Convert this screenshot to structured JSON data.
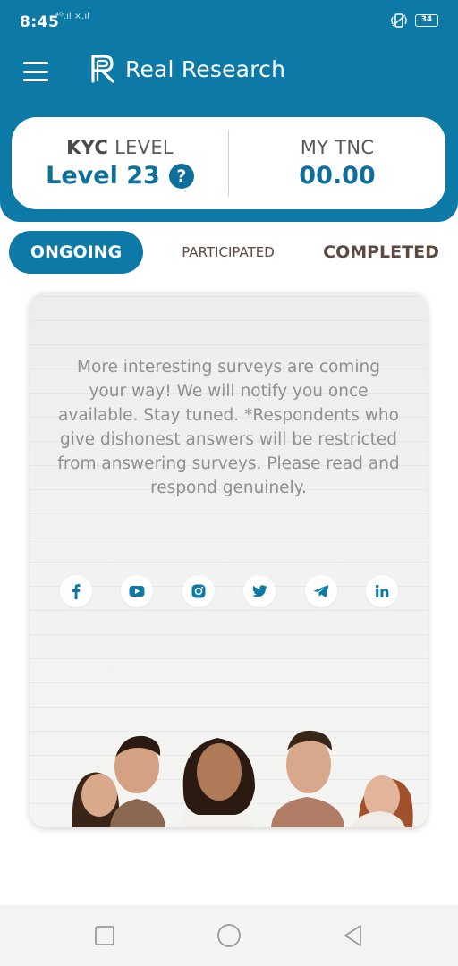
{
  "status_bar": {
    "time": "8:45",
    "signal": "⁴ᴳ.ıl ×.ıl",
    "battery": "34",
    "icons": [
      "vibrate-icon",
      "battery-icon"
    ]
  },
  "app": {
    "brand_name": "Real Research",
    "accent_color": "#0d79a6"
  },
  "stats": {
    "kyc_label_bold": "KYC",
    "kyc_label_rest": " LEVEL",
    "kyc_value": "Level 23",
    "help_symbol": "?",
    "tnc_label": "MY TNC",
    "tnc_value": "00.00"
  },
  "tabs": [
    {
      "label": "ONGOING",
      "active": true
    },
    {
      "label": "PARTICIPATED",
      "active": false
    },
    {
      "label": "COMPLETED",
      "active": false
    }
  ],
  "card": {
    "message": "More interesting surveys are coming your way! We will notify you once available. Stay tuned.  *Respondents who give dishonest answers will be restricted from answering surveys. Please read and respond genuinely.",
    "social_icons": [
      "facebook-icon",
      "youtube-icon",
      "instagram-icon",
      "twitter-icon",
      "telegram-icon",
      "linkedin-icon"
    ]
  },
  "navbar": {
    "icons": [
      "recents-icon",
      "home-icon",
      "back-icon"
    ]
  }
}
